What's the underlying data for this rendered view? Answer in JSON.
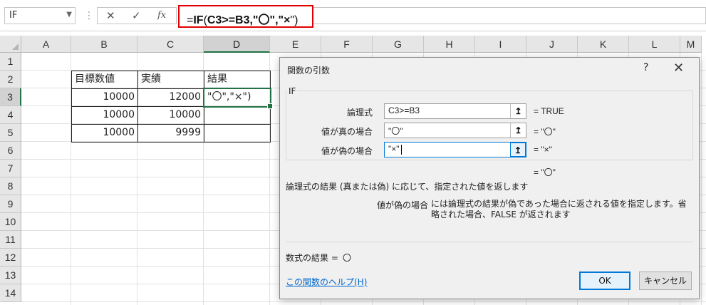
{
  "formula_bar": {
    "name_box": "IF",
    "dots": "⋮",
    "cancel_glyph": "✕",
    "enter_glyph": "✓",
    "fx_glyph": "fx",
    "formula_prefix": "=",
    "formula_fn": "IF",
    "formula_paren_open": "(",
    "formula_args": "C3>=B3,\"〇\",\"×",
    "formula_paren_close": "\")"
  },
  "sheet": {
    "columns": [
      "A",
      "B",
      "C",
      "D",
      "E",
      "F",
      "G",
      "H",
      "I",
      "J",
      "K",
      "L",
      "M"
    ],
    "rows": [
      "1",
      "2",
      "3",
      "4",
      "5",
      "6",
      "7",
      "8",
      "9",
      "10",
      "11",
      "12",
      "13",
      "14"
    ],
    "header": {
      "b": "目標数値",
      "c": "実績",
      "d": "結果"
    },
    "data": [
      {
        "b": "10000",
        "c": "12000",
        "d": "\"〇\",\"×\")"
      },
      {
        "b": "10000",
        "c": "10000",
        "d": ""
      },
      {
        "b": "10000",
        "c": "9999",
        "d": ""
      }
    ]
  },
  "dialog": {
    "title": "関数の引数",
    "help_glyph": "?",
    "close_glyph": "✕",
    "function_name": "IF",
    "args": [
      {
        "label": "論理式",
        "value": "C3>=B3",
        "result": "=  TRUE"
      },
      {
        "label": "値が真の場合",
        "value": "\"〇\"",
        "result": "=  \"〇\""
      },
      {
        "label": "値が偽の場合",
        "value": "\"×\"",
        "result": "=  \"×\""
      }
    ],
    "collapse_glyph": "↥",
    "overall_result": "=  \"〇\"",
    "function_description": "論理式の結果 (真または偽) に応じて、指定された値を返します",
    "arg_desc_label": "値が偽の場合",
    "arg_desc_text": "には論理式の結果が偽であった場合に返される値を指定します。省略された場合、FALSE が返されます",
    "formula_result_label": "数式の結果 =",
    "formula_result_value": "〇",
    "help_link": "この関数のヘルプ(H)",
    "ok_label": "OK",
    "cancel_label": "キャンセル"
  }
}
